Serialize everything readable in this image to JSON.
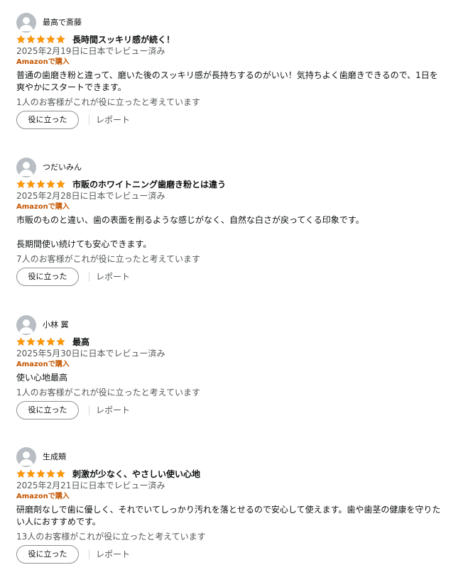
{
  "reviews": [
    {
      "author": "最高で斎藤",
      "rating": 5,
      "title": "長時間スッキリ感が続く！",
      "date": "2025年2月19日に日本でレビュー済み",
      "verified": "Amazonで購入",
      "body": [
        "普通の歯磨き粉と違って、磨いた後のスッキリ感が長持ちするのがいい！気持ちよく歯磨きできるので、1日を爽やかにスタートできます。"
      ],
      "helpful_count": "1人のお客様がこれが役に立ったと考えています",
      "helpful_button": "役に立った",
      "report": "レポート"
    },
    {
      "author": "つだいみん",
      "rating": 5,
      "title": "市販のホワイトニング歯磨き粉とは違う",
      "date": "2025年2月28日に日本でレビュー済み",
      "verified": "Amazonで購入",
      "body": [
        "市販のものと違い、歯の表面を削るような感じがなく、自然な白さが戻ってくる印象です。",
        "長期間使い続けても安心できます。"
      ],
      "helpful_count": "7人のお客様がこれが役に立ったと考えています",
      "helpful_button": "役に立った",
      "report": "レポート"
    },
    {
      "author": "小林 翼",
      "rating": 5,
      "title": "最高",
      "date": "2025年5月30日に日本でレビュー済み",
      "verified": "Amazonで購入",
      "body": [
        "使い心地最高"
      ],
      "helpful_count": "1人のお客様がこれが役に立ったと考えています",
      "helpful_button": "役に立った",
      "report": "レポート"
    },
    {
      "author": "生成頬",
      "rating": 5,
      "title": "刺激が少なく、やさしい使い心地",
      "date": "2025年2月21日に日本でレビュー済み",
      "verified": "Amazonで購入",
      "body": [
        "研磨剤なしで歯に優しく、それでいてしっかり汚れを落とせるので安心して使えます。歯や歯茎の健康を守りたい人におすすめです。"
      ],
      "helpful_count": "13人のお客様がこれが役に立ったと考えています",
      "helpful_button": "役に立った",
      "report": "レポート"
    }
  ],
  "colors": {
    "star": "#ff9900",
    "verified": "#c45500",
    "muted_text": "#565959"
  },
  "icons": {
    "avatar": "default-user-avatar-icon",
    "star": "filled-star-icon"
  }
}
